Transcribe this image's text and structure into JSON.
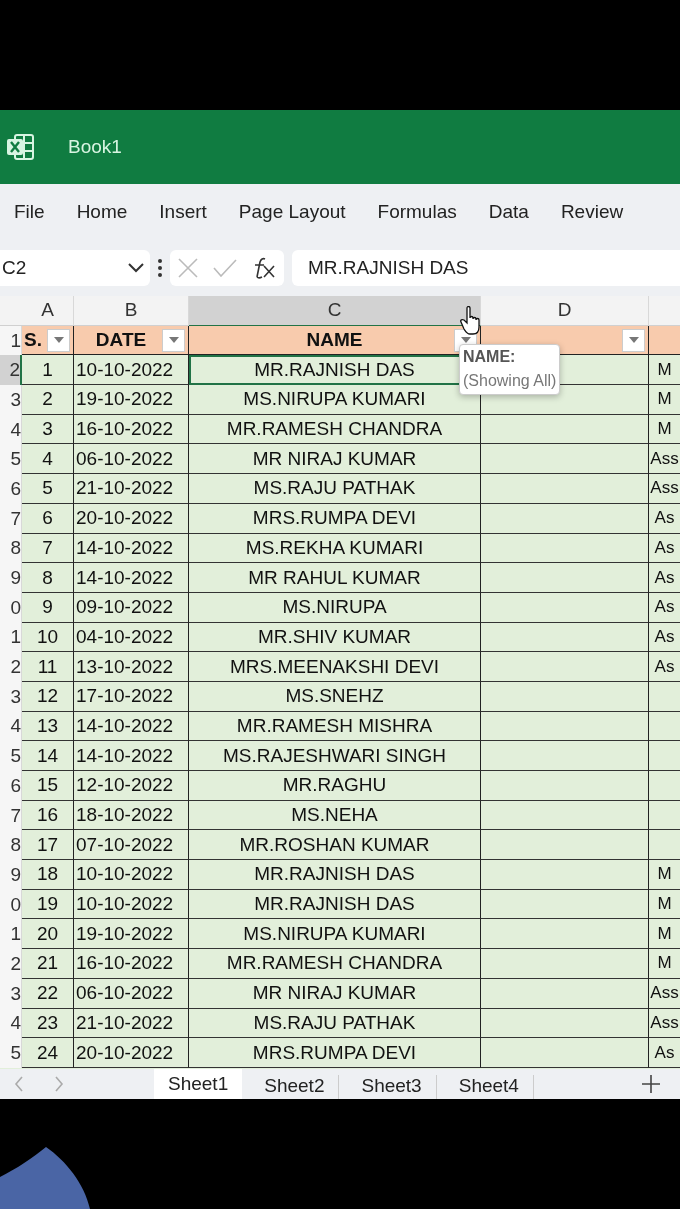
{
  "window": {
    "title": "Book1"
  },
  "ribbon_tabs": [
    "File",
    "Home",
    "Insert",
    "Page Layout",
    "Formulas",
    "Data",
    "Review"
  ],
  "formula_bar": {
    "name_box": "C2",
    "formula": "MR.RAJNISH DAS"
  },
  "columns": [
    {
      "label": "A",
      "selected": false
    },
    {
      "label": "B",
      "selected": false
    },
    {
      "label": "C",
      "selected": true
    },
    {
      "label": "D",
      "selected": false
    }
  ],
  "header_row": {
    "row_label": "1",
    "sn": "S.",
    "date": "DATE",
    "name": "NAME"
  },
  "rows": [
    {
      "row_label": "2",
      "sn": "1",
      "date": "10-10-2022",
      "name": "MR.RAJNISH DAS",
      "column_5": "M",
      "selected": true
    },
    {
      "row_label": "3",
      "sn": "2",
      "date": "19-10-2022",
      "name": "MS.NIRUPA KUMARI",
      "column_5": "M",
      "selected": false
    },
    {
      "row_label": "4",
      "sn": "3",
      "date": "16-10-2022",
      "name": "MR.RAMESH CHANDRA",
      "column_5": "M",
      "selected": false
    },
    {
      "row_label": "5",
      "sn": "4",
      "date": "06-10-2022",
      "name": "MR NIRAJ KUMAR",
      "column_5": "Ass",
      "selected": false
    },
    {
      "row_label": "6",
      "sn": "5",
      "date": "21-10-2022",
      "name": "MS.RAJU PATHAK",
      "column_5": "Ass",
      "selected": false
    },
    {
      "row_label": "7",
      "sn": "6",
      "date": "20-10-2022",
      "name": "MRS.RUMPA DEVI",
      "column_5": "As",
      "selected": false
    },
    {
      "row_label": "8",
      "sn": "7",
      "date": "14-10-2022",
      "name": "MS.REKHA KUMARI",
      "column_5": "As",
      "selected": false
    },
    {
      "row_label": "9",
      "sn": "8",
      "date": "14-10-2022",
      "name": "MR RAHUL KUMAR",
      "column_5": "As",
      "selected": false
    },
    {
      "row_label": "0",
      "sn": "9",
      "date": "09-10-2022",
      "name": "MS.NIRUPA",
      "column_5": "As",
      "selected": false
    },
    {
      "row_label": "1",
      "sn": "10",
      "date": "04-10-2022",
      "name": "MR.SHIV KUMAR",
      "column_5": "As",
      "selected": false
    },
    {
      "row_label": "2",
      "sn": "11",
      "date": "13-10-2022",
      "name": "MRS.MEENAKSHI DEVI",
      "column_5": "As",
      "selected": false
    },
    {
      "row_label": "3",
      "sn": "12",
      "date": "17-10-2022",
      "name": "MS.SNEHZ",
      "selected": false
    },
    {
      "row_label": "4",
      "sn": "13",
      "date": "14-10-2022",
      "name": "MR.RAMESH MISHRA",
      "selected": false
    },
    {
      "row_label": "5",
      "sn": "14",
      "date": "14-10-2022",
      "name": "MS.RAJESHWARI SINGH",
      "selected": false
    },
    {
      "row_label": "6",
      "sn": "15",
      "date": "12-10-2022",
      "name": "MR.RAGHU",
      "selected": false
    },
    {
      "row_label": "7",
      "sn": "16",
      "date": "18-10-2022",
      "name": "MS.NEHA",
      "selected": false
    },
    {
      "row_label": "8",
      "sn": "17",
      "date": "07-10-2022",
      "name": "MR.ROSHAN KUMAR",
      "selected": false
    },
    {
      "row_label": "9",
      "sn": "18",
      "date": "10-10-2022",
      "name": "MR.RAJNISH DAS",
      "column_5": "M",
      "selected": false
    },
    {
      "row_label": "0",
      "sn": "19",
      "date": "10-10-2022",
      "name": "MR.RAJNISH DAS",
      "column_5": "M",
      "selected": false
    },
    {
      "row_label": "1",
      "sn": "20",
      "date": "19-10-2022",
      "name": "MS.NIRUPA KUMARI",
      "column_5": "M",
      "selected": false
    },
    {
      "row_label": "2",
      "sn": "21",
      "date": "16-10-2022",
      "name": "MR.RAMESH CHANDRA",
      "column_5": "M",
      "selected": false
    },
    {
      "row_label": "3",
      "sn": "22",
      "date": "06-10-2022",
      "name": "MR NIRAJ KUMAR",
      "column_5": "Ass",
      "selected": false
    },
    {
      "row_label": "4",
      "sn": "23",
      "date": "21-10-2022",
      "name": "MS.RAJU PATHAK",
      "column_5": "Ass",
      "selected": false
    },
    {
      "row_label": "5",
      "sn": "24",
      "date": "20-10-2022",
      "name": "MRS.RUMPA DEVI",
      "column_5": "As",
      "selected": false
    }
  ],
  "tooltip": {
    "title": "NAME:",
    "text": "(Showing All)"
  },
  "sheet_tabs": [
    {
      "label": "Sheet1",
      "selected": true
    },
    {
      "label": "Sheet2",
      "selected": false
    },
    {
      "label": "Sheet3",
      "selected": false
    },
    {
      "label": "Sheet4",
      "selected": false
    }
  ]
}
